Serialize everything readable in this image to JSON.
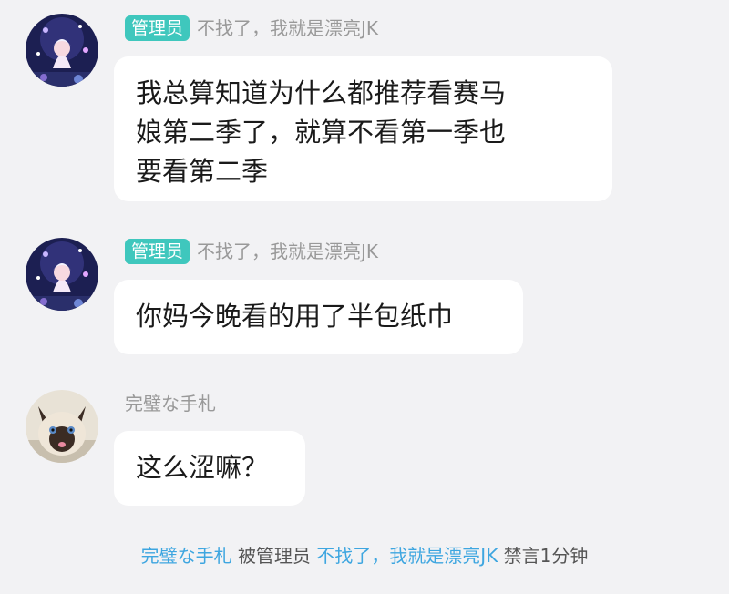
{
  "colors": {
    "background": "#f2f2f4",
    "admin_badge": "#3fc7bd",
    "link": "#3ea6e0",
    "nickname": "#999999"
  },
  "messages": [
    {
      "avatar": "anime-girl-avatar",
      "badge": "管理员",
      "nickname": "不找了，我就是漂亮JK",
      "lines": [
        "我总算知道为什么都推荐看赛马",
        "娘第二季了，就算不看第一季也",
        "要看第二季"
      ]
    },
    {
      "avatar": "anime-girl-avatar",
      "badge": "管理员",
      "nickname": "不找了，我就是漂亮JK",
      "lines": [
        "你妈今晚看的用了半包纸巾"
      ]
    },
    {
      "avatar": "cat-avatar",
      "nickname": "完璧な手札",
      "lines": [
        "这么涩嘛？"
      ]
    }
  ],
  "notice": {
    "target": "完璧な手札",
    "by": "被管理员",
    "admin": "不找了，我就是漂亮JK",
    "action": "禁言1分钟"
  }
}
